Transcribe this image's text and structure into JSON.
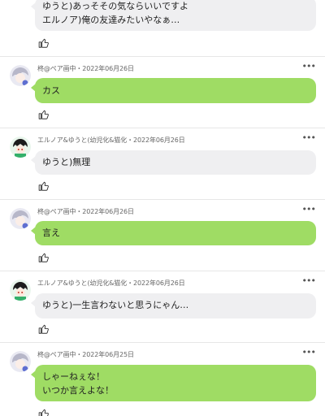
{
  "colors": {
    "own_bubble": "#9fdc64",
    "other_bubble": "#efeff1",
    "meta_text": "#666666",
    "divider": "#e6e6e6"
  },
  "icons": {
    "like": "thumbs-up-icon",
    "more": "more-options-icon"
  },
  "more_label": "•••",
  "posts": [
    {
      "author_type": "other",
      "author_meta": "",
      "text": "ゆうと)あっそその気ならいいですよ\nエルノア)俺の友達みたいやなぁ…"
    },
    {
      "author_type": "self",
      "author_meta": "柊@ペア画中・2022年06月26日",
      "text": "カス"
    },
    {
      "author_type": "other",
      "author_meta": "エルノア&ゆうと(幼児化&猫化・2022年06月26日",
      "text": "ゆうと)無理"
    },
    {
      "author_type": "self",
      "author_meta": "柊@ペア画中・2022年06月26日",
      "text": "言え"
    },
    {
      "author_type": "other",
      "author_meta": "エルノア&ゆうと(幼児化&猫化・2022年06月26日",
      "text": "ゆうと)一生言わないと思うにゃん…"
    },
    {
      "author_type": "self",
      "author_meta": "柊@ペア画中・2022年06月25日",
      "text": "しゃーねぇな！\nいつか言えよな！"
    }
  ]
}
